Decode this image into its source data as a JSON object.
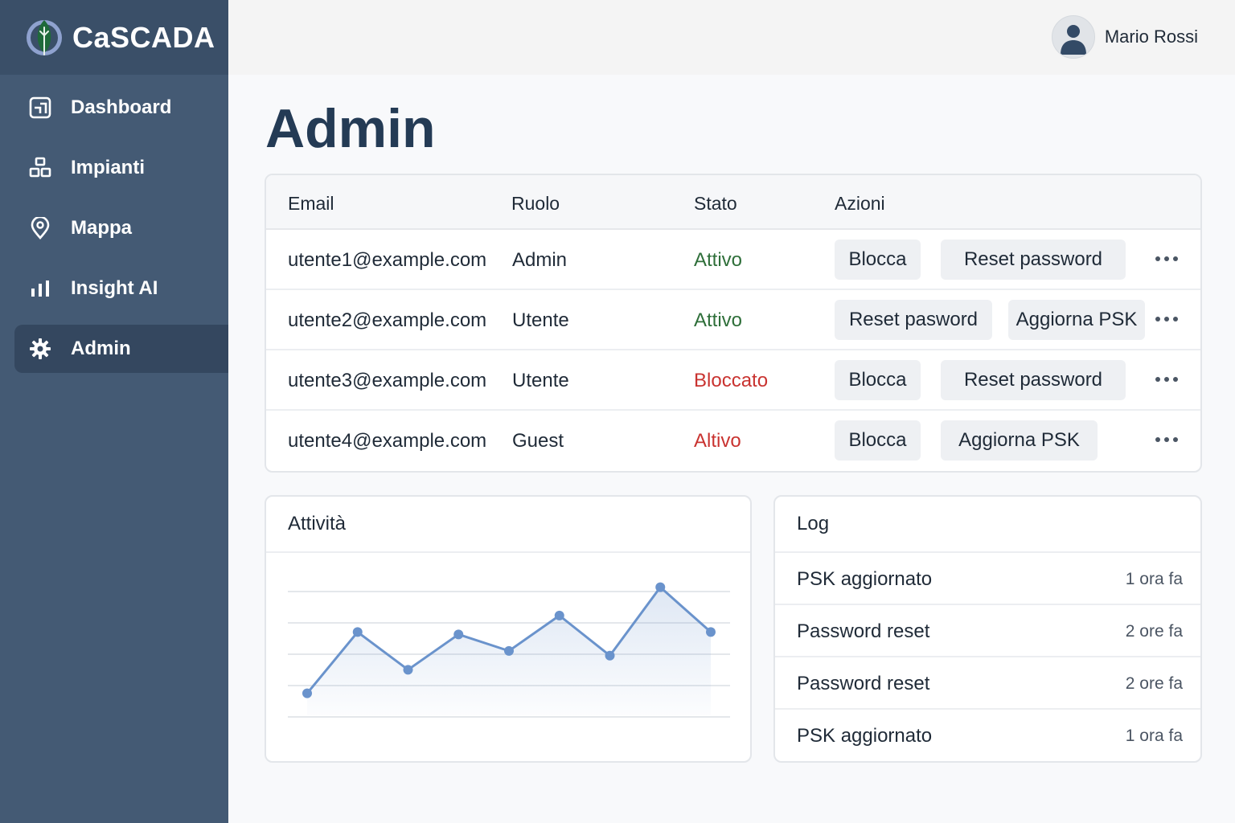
{
  "brand": {
    "name": "CaSCADA"
  },
  "sidebar": {
    "items": [
      {
        "label": "Dashboard",
        "icon": "dashboard-icon"
      },
      {
        "label": "Impianti",
        "icon": "plants-icon"
      },
      {
        "label": "Mappa",
        "icon": "map-pin-icon"
      },
      {
        "label": "Insight AI",
        "icon": "bar-chart-icon"
      },
      {
        "label": "Admin",
        "icon": "gear-icon",
        "active": true
      }
    ]
  },
  "user": {
    "name": "Mario Rossi"
  },
  "page": {
    "title": "Admin"
  },
  "users_table": {
    "headers": [
      "Email",
      "Ruolo",
      "Stato",
      "Azioni"
    ],
    "rows": [
      {
        "email": "utente1@example.com",
        "role": "Admin",
        "status": "Attivo",
        "status_color": "#2f6f3a",
        "actions": [
          "Blocca",
          "Reset password"
        ]
      },
      {
        "email": "utente2@example.com",
        "role": "Utente",
        "status": "Attivo",
        "status_color": "#2f6f3a",
        "actions": [
          "Reset pasword",
          "Aggiorna PSK"
        ]
      },
      {
        "email": "utente3@example.com",
        "role": "Utente",
        "status": "Bloccato",
        "status_color": "#c93330",
        "actions": [
          "Blocca",
          "Reset password"
        ]
      },
      {
        "email": "utente4@example.com",
        "role": "Guest",
        "status": "Altivo",
        "status_color": "#c93330",
        "actions": [
          "Blocca",
          "Aggiorna PSK"
        ]
      }
    ]
  },
  "activity": {
    "title": "Attività",
    "chart_data": {
      "type": "line",
      "x": [
        1,
        2,
        3,
        4,
        5,
        6,
        7,
        8,
        9
      ],
      "series": [
        {
          "values": [
            10,
            36,
            20,
            35,
            28,
            43,
            26,
            55,
            36
          ]
        }
      ],
      "ylim": [
        0,
        60
      ],
      "grid": true,
      "color": "#6a93cc"
    }
  },
  "log": {
    "title": "Log",
    "entries": [
      {
        "text": "PSK aggiornato",
        "time": "1 ora fa"
      },
      {
        "text": "Password reset",
        "time": "2 ore fa"
      },
      {
        "text": "Password reset",
        "time": "2 ore fa"
      },
      {
        "text": "PSK aggiornato",
        "time": "1 ora fa"
      }
    ]
  }
}
